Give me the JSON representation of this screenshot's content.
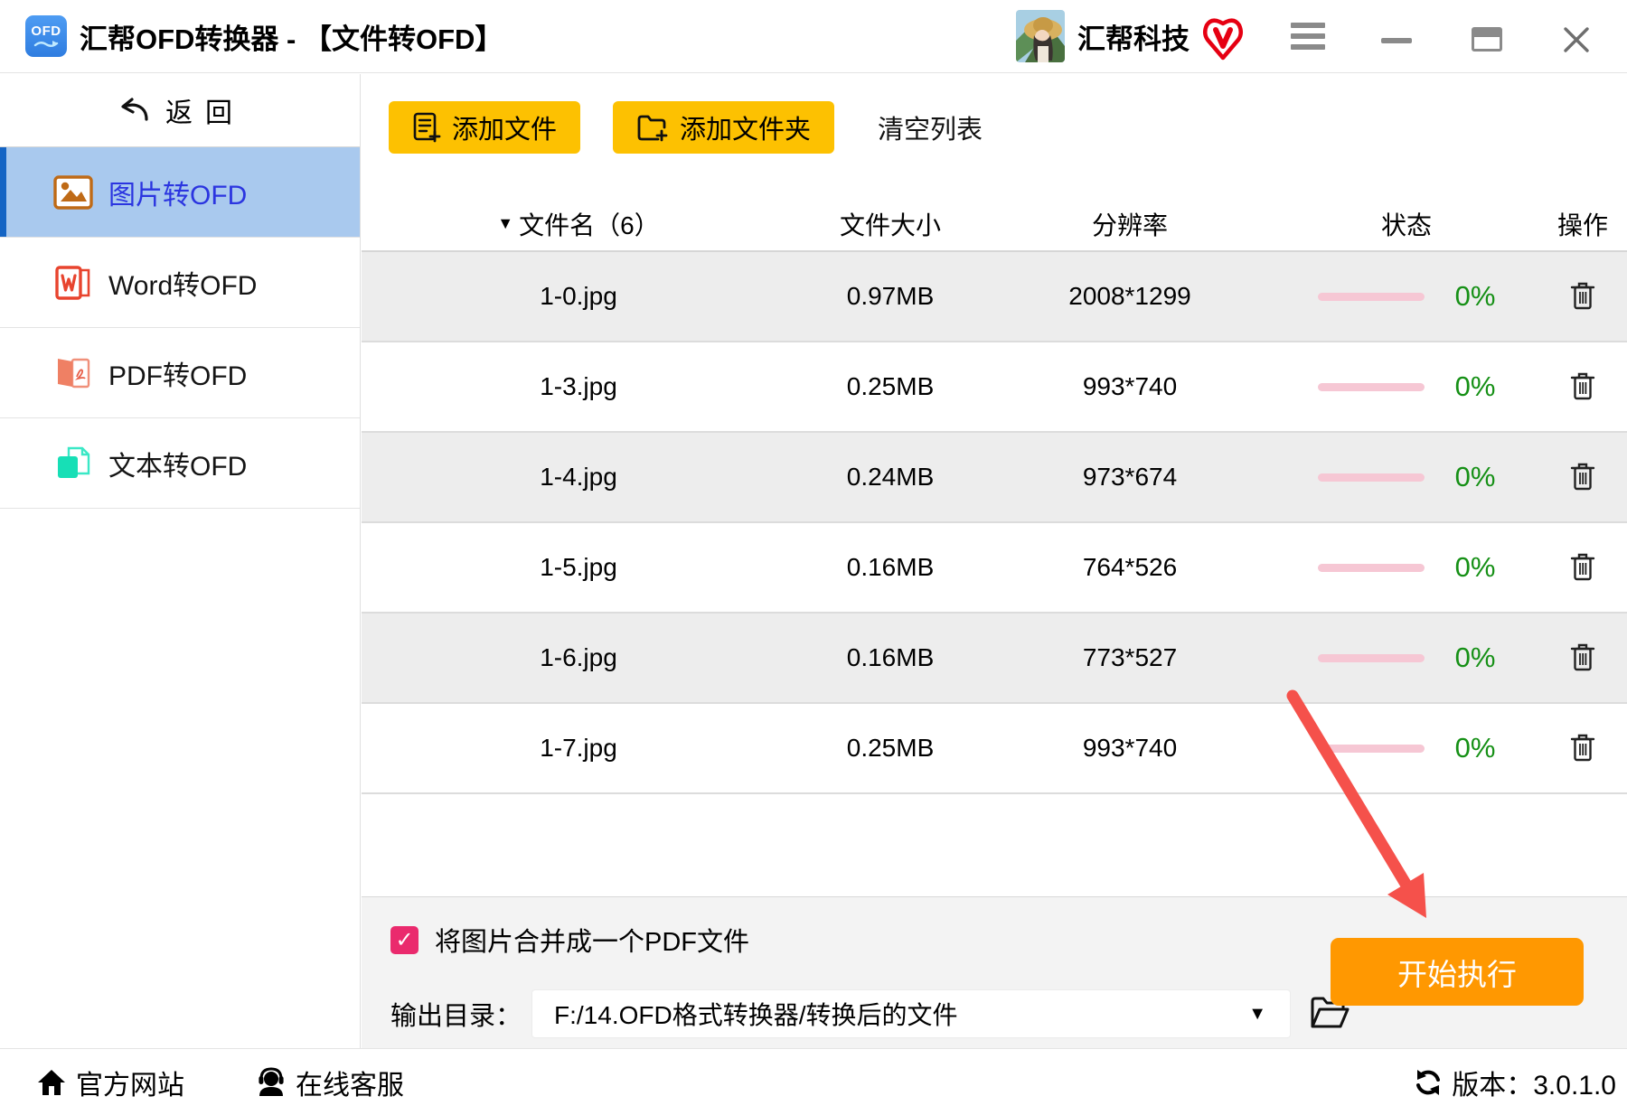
{
  "window": {
    "title": "汇帮OFD转换器 - 【文件转OFD】",
    "logo_text": "OFD",
    "brand": "汇帮科技"
  },
  "sidebar": {
    "back_label": "返回",
    "items": [
      {
        "label": "图片转OFD",
        "icon": "image-icon",
        "active": true
      },
      {
        "label": "Word转OFD",
        "icon": "word-icon",
        "active": false
      },
      {
        "label": "PDF转OFD",
        "icon": "pdf-icon",
        "active": false
      },
      {
        "label": "文本转OFD",
        "icon": "text-icon",
        "active": false
      }
    ]
  },
  "toolbar": {
    "add_file": "添加文件",
    "add_folder": "添加文件夹",
    "clear_list": "清空列表"
  },
  "table": {
    "headers": {
      "name": "文件名（6）",
      "size": "文件大小",
      "resolution": "分辨率",
      "status": "状态",
      "action": "操作"
    },
    "rows": [
      {
        "name": "1-0.jpg",
        "size": "0.97MB",
        "resolution": "2008*1299",
        "progress": "0%"
      },
      {
        "name": "1-3.jpg",
        "size": "0.25MB",
        "resolution": "993*740",
        "progress": "0%"
      },
      {
        "name": "1-4.jpg",
        "size": "0.24MB",
        "resolution": "973*674",
        "progress": "0%"
      },
      {
        "name": "1-5.jpg",
        "size": "0.16MB",
        "resolution": "764*526",
        "progress": "0%"
      },
      {
        "name": "1-6.jpg",
        "size": "0.16MB",
        "resolution": "773*527",
        "progress": "0%"
      },
      {
        "name": "1-7.jpg",
        "size": "0.25MB",
        "resolution": "993*740",
        "progress": "0%"
      }
    ]
  },
  "options": {
    "merge_label": "将图片合并成一个PDF文件",
    "merge_checked": true,
    "output_dir_label": "输出目录：",
    "output_dir_value": "F:/14.OFD格式转换器/转换后的文件",
    "start_button": "开始执行"
  },
  "footer": {
    "official_site": "官方网站",
    "online_support": "在线客服",
    "version": "版本：3.0.1.0"
  },
  "icons": {
    "sort_caret": "▼",
    "dropdown_caret": "▼",
    "check_mark": "✓"
  },
  "colors": {
    "sidebar_active_bg": "#a9c9ee",
    "sidebar_active_accent": "#1464c4",
    "sidebar_active_text": "#2b35e0",
    "button_yellow": "#fdc101",
    "button_orange": "#ff9801",
    "checkbox_pink": "#ea2a6d",
    "progress_pink": "#f6c7d4",
    "percent_green": "#169016",
    "arrow_red": "#f5514b"
  }
}
